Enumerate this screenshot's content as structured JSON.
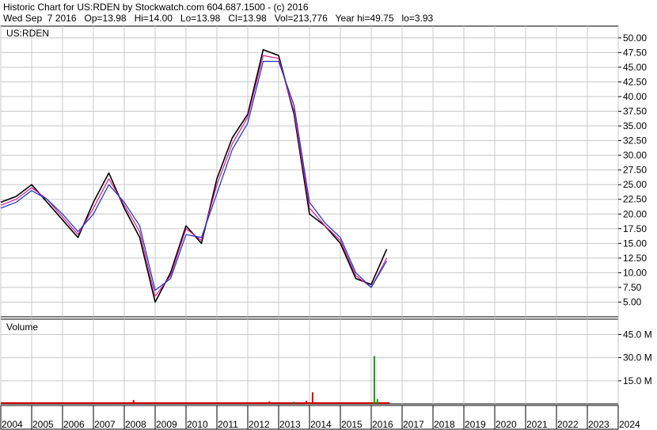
{
  "header": {
    "line1": "Historic Chart for US:RDEN by Stockwatch.com 604.687.1500 - (c) 2016",
    "line2": "Wed Sep  7 2016   Op=13.98   Hi=14.00   Lo=13.98   Cl=13.98   Vol=213,776   Year hi=49.75   lo=3.93"
  },
  "chart_data": {
    "type": "line",
    "symbol_label": "US:RDEN",
    "volume_label": "Volume",
    "x": [
      "2004",
      "2004.5",
      "2005",
      "2005.5",
      "2006",
      "2006.5",
      "2007",
      "2007.5",
      "2008",
      "2008.5",
      "2009",
      "2009.5",
      "2010",
      "2010.5",
      "2011",
      "2011.5",
      "2012",
      "2012.5",
      "2013",
      "2013.5",
      "2014",
      "2014.5",
      "2015",
      "2015.5",
      "2016",
      "2016.5"
    ],
    "series": [
      {
        "name": "",
        "color": "#000000",
        "values": [
          22,
          23,
          25,
          22,
          19,
          16,
          22,
          27,
          21,
          16,
          5,
          10,
          18,
          15,
          26,
          33,
          37,
          48,
          47,
          37,
          20,
          18,
          15,
          9,
          8,
          14
        ]
      },
      {
        "name": "",
        "color": "#d81b8a",
        "values": [
          21.5,
          22.5,
          24.5,
          22.5,
          19.5,
          16.5,
          21,
          26,
          21.5,
          17,
          6,
          9.5,
          17.5,
          15.5,
          25,
          32,
          36.5,
          47,
          46.5,
          37.5,
          21,
          18,
          15.5,
          9.5,
          7.5,
          12.5
        ]
      },
      {
        "name": "",
        "color": "#1a2fd0",
        "values": [
          21,
          22,
          24,
          22.5,
          20,
          17,
          20,
          25,
          22,
          18,
          7,
          9,
          16.5,
          16,
          23.5,
          31,
          35.5,
          46,
          46,
          38.5,
          22,
          18.5,
          16,
          10,
          7.5,
          12
        ]
      }
    ],
    "price_axis": {
      "ticks": [
        "50.00",
        "47.50",
        "45.00",
        "42.50",
        "40.00",
        "37.50",
        "35.00",
        "32.50",
        "30.00",
        "27.50",
        "25.00",
        "22.50",
        "20.00",
        "17.50",
        "15.00",
        "12.50",
        "10.00",
        "7.50",
        "5.00"
      ],
      "ylim": [
        2.5,
        52
      ]
    },
    "volume": {
      "ticks": [
        "45.0 M",
        "30.0 M",
        "15.0 M"
      ],
      "ylim": [
        0,
        55
      ],
      "bars": [
        {
          "x": 2008.3,
          "value": 2.5,
          "color": "#d10000"
        },
        {
          "x": 2012.7,
          "value": 1.5,
          "color": "#d10000"
        },
        {
          "x": 2013.5,
          "value": 1.3,
          "color": "#008000"
        },
        {
          "x": 2013.9,
          "value": 2.0,
          "color": "#d10000"
        },
        {
          "x": 2014.1,
          "value": 7.5,
          "color": "#d10000"
        },
        {
          "x": 2016.1,
          "value": 31.0,
          "color": "#00a000"
        },
        {
          "x": 2016.2,
          "value": 3.0,
          "color": "#00a000"
        }
      ]
    },
    "x_ticks": [
      "2004",
      "2005",
      "2006",
      "2007",
      "2008",
      "2009",
      "2010",
      "2011",
      "2012",
      "2013",
      "2014",
      "2015",
      "2016",
      "2017",
      "2018",
      "2019",
      "2020",
      "2021",
      "2022",
      "2023",
      "2024"
    ],
    "xlim": [
      2004,
      2024
    ],
    "grid": true
  }
}
